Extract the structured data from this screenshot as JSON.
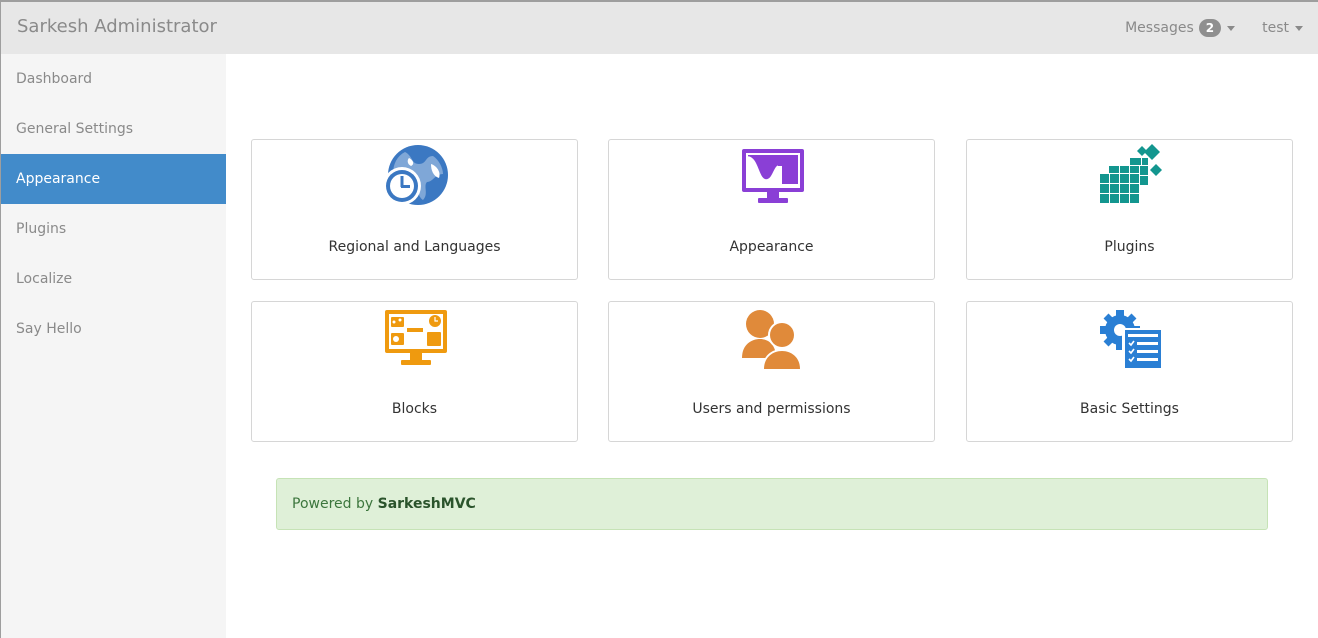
{
  "header": {
    "brand": "Sarkesh Administrator",
    "messages_label": "Messages",
    "messages_count": "2",
    "user_label": "test"
  },
  "sidebar": {
    "items": [
      {
        "label": "Dashboard",
        "active": false
      },
      {
        "label": "General Settings",
        "active": false
      },
      {
        "label": "Appearance",
        "active": true
      },
      {
        "label": "Plugins",
        "active": false
      },
      {
        "label": "Localize",
        "active": false
      },
      {
        "label": "Say Hello",
        "active": false
      }
    ]
  },
  "tiles": [
    {
      "label": "Regional and Languages",
      "icon": "globe-clock-icon",
      "color": "#3b78c2"
    },
    {
      "label": "Appearance",
      "icon": "monitor-chart-icon",
      "color": "#8a3fd6"
    },
    {
      "label": "Plugins",
      "icon": "cubes-icon",
      "color": "#13968f"
    },
    {
      "label": "Blocks",
      "icon": "monitor-blocks-icon",
      "color": "#ef9a0f"
    },
    {
      "label": "Users and permissions",
      "icon": "users-icon",
      "color": "#e08a3a"
    },
    {
      "label": "Basic Settings",
      "icon": "gear-list-icon",
      "color": "#2a7fd4"
    }
  ],
  "footer": {
    "prefix": "Powered by",
    "brand": "SarkeshMVC"
  }
}
